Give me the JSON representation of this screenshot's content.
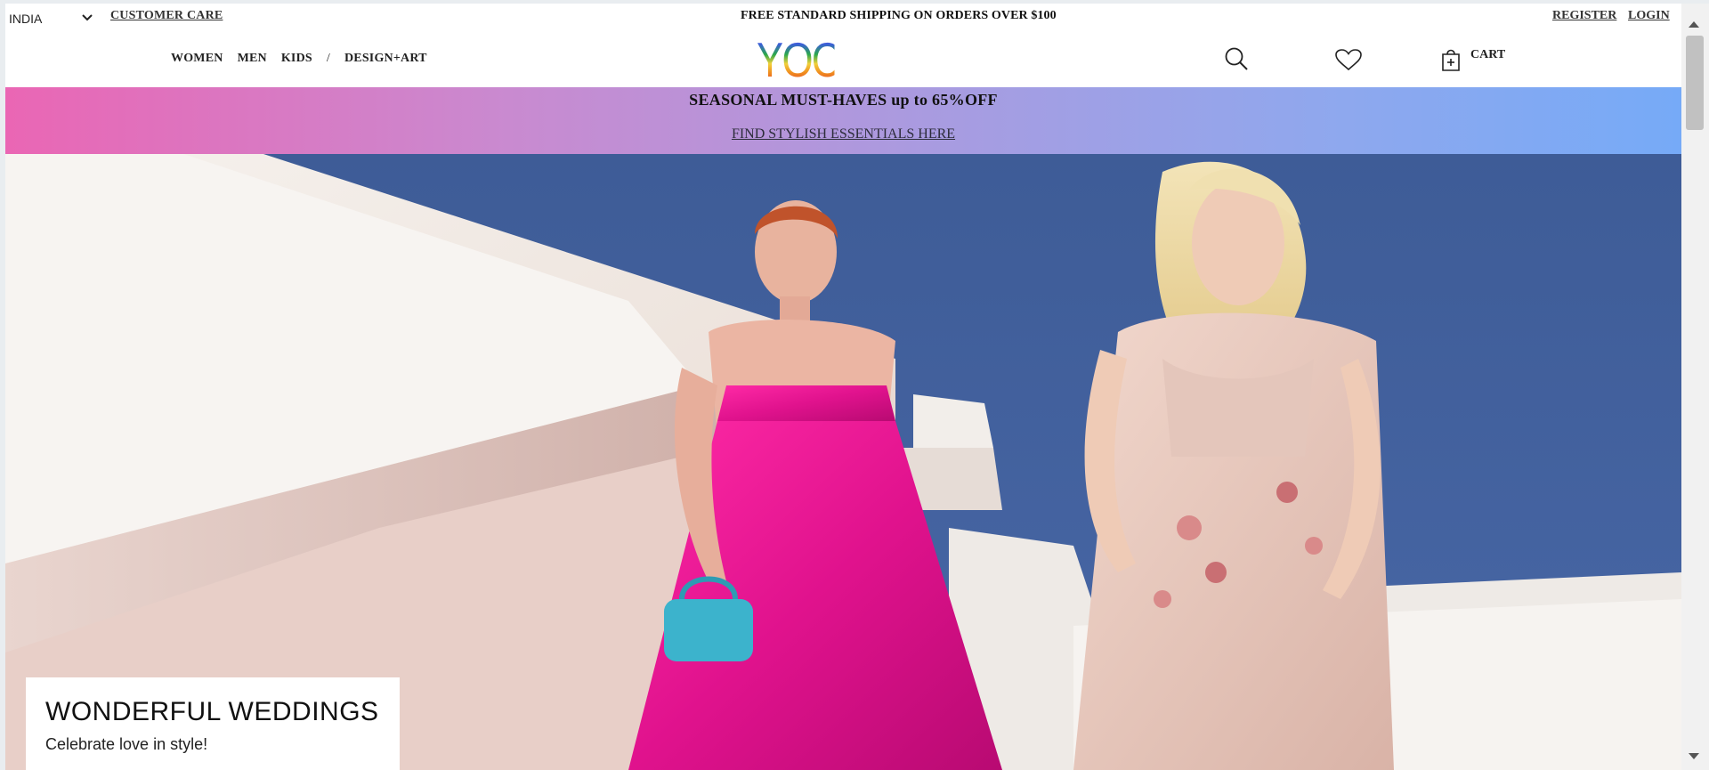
{
  "topbar": {
    "country": "INDIA",
    "customer_care": "CUSTOMER CARE",
    "shipping": "FREE STANDARD SHIPPING ON ORDERS OVER $100",
    "register": "REGISTER",
    "login": "LOGIN"
  },
  "nav": {
    "items": [
      "WOMEN",
      "MEN",
      "KIDS"
    ],
    "separator": "/",
    "design_art": "DESIGN+ART"
  },
  "brand": {
    "logo": "YOOX"
  },
  "actions": {
    "search_icon": "search-icon",
    "wishlist_icon": "heart-icon",
    "cart_icon": "shopping-bag-icon",
    "cart_label": "CART"
  },
  "promo": {
    "title": "SEASONAL MUST-HAVES up to 65%OFF",
    "link": "FIND STYLISH ESSENTIALS HERE",
    "gradient_start": "#ea66b4",
    "gradient_end": "#76aaf7"
  },
  "hero": {
    "card_title": "WONDERFUL WEDDINGS",
    "card_subtitle": "Celebrate love in style!",
    "sky_color": "#3f5f9c",
    "wall_color": "#f3eee9"
  }
}
